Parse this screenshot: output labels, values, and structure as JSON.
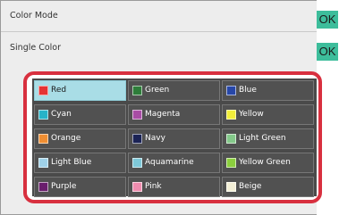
{
  "rows": [
    {
      "label": "Color Mode",
      "button": "OK"
    },
    {
      "label": "Single Color",
      "button": "OK"
    }
  ],
  "colors": [
    {
      "label": "Red",
      "swatch": "#e53333",
      "selected": true
    },
    {
      "label": "Green",
      "swatch": "#2e7d3a"
    },
    {
      "label": "Blue",
      "swatch": "#2747a8"
    },
    {
      "label": "Cyan",
      "swatch": "#27b3c8"
    },
    {
      "label": "Magenta",
      "swatch": "#a84ca5"
    },
    {
      "label": "Yellow",
      "swatch": "#f2ee3a"
    },
    {
      "label": "Orange",
      "swatch": "#f08e32"
    },
    {
      "label": "Navy",
      "swatch": "#1b2355"
    },
    {
      "label": "Light Green",
      "swatch": "#84c98a"
    },
    {
      "label": "Light Blue",
      "swatch": "#9fd1e8"
    },
    {
      "label": "Aquamarine",
      "swatch": "#7ec8d8"
    },
    {
      "label": "Yellow Green",
      "swatch": "#8bcf3e"
    },
    {
      "label": "Purple",
      "swatch": "#6a1e6d"
    },
    {
      "label": "Pink",
      "swatch": "#f08caf"
    },
    {
      "label": "Beige",
      "swatch": "#f3efd6"
    }
  ],
  "theme": {
    "ok_button": "#3dbd9b",
    "highlight_border": "#d8303f",
    "selected_cell": "#a9dde6"
  }
}
